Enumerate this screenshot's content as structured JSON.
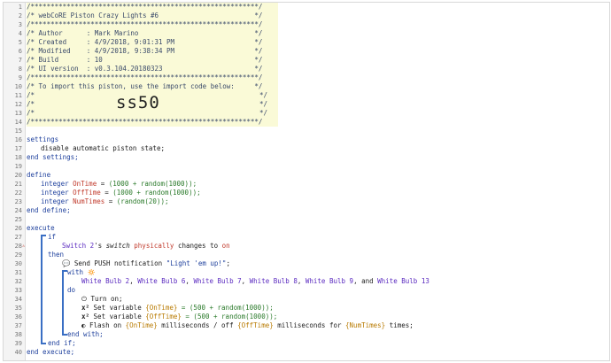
{
  "gutter": {
    "lines": [
      "1",
      "2",
      "3",
      "4",
      "5",
      "6",
      "7",
      "8",
      "9",
      "10",
      "11",
      "12",
      "13",
      "14",
      "15",
      "16",
      "17",
      "18",
      "19",
      "20",
      "21",
      "22",
      "23",
      "24",
      "25",
      "26",
      "27",
      "28",
      "29",
      "30",
      "31",
      "32",
      "33",
      "34",
      "35",
      "36",
      "37",
      "38",
      "39",
      "40"
    ],
    "error_marker": "⚠"
  },
  "header": {
    "rule": "/*********************************************************/",
    "title": "/* webCoRE Piston Crazy Lights #6                        */",
    "author": "/* Author      : Mark Marino                             */",
    "created": "/* Created     : 4/9/2018, 9:01:31 PM                    */",
    "modified": "/* Modified    : 4/9/2018, 9:38:34 PM                    */",
    "build": "/* Build       : 10                                      */",
    "ui_version": "/* UI version  : v0.3.104.20180323                       */",
    "import_text": "/* To import this piston, use the import code below:     */",
    "blank_left": "/*",
    "blank_right": "*/",
    "import_code": "ss50"
  },
  "settings": {
    "open": "settings",
    "body": "disable automatic piston state;",
    "close": "end settings;"
  },
  "define": {
    "open": "define",
    "close": "end define;",
    "vars": [
      {
        "type": "integer",
        "name": "OnTime",
        "eq": " = ",
        "value": "(1000 + random(1000));"
      },
      {
        "type": "integer",
        "name": "OffTime",
        "eq": " = ",
        "value": "(1000 + random(1000));"
      },
      {
        "type": "integer",
        "name": "NumTimes",
        "eq": " = ",
        "value": "(random(20));"
      }
    ]
  },
  "execute": {
    "open": "execute",
    "close": "end execute;",
    "if_kw": "if",
    "cond_device": "Switch 2",
    "cond_poss": "'s ",
    "cond_attr": "switch",
    "cond_phys": "physically",
    "cond_changes": " changes to ",
    "cond_value": "on",
    "then_kw": "then",
    "push_icon": "💬",
    "push_text": "Send PUSH notification ",
    "push_msg": "\"Light 'em up!\"",
    "push_end": ";",
    "with_kw": "with",
    "with_icon": "🔅",
    "devices": [
      {
        "name": "White Bulb 2",
        "sep": ", "
      },
      {
        "name": "White Bulb 6",
        "sep": ", "
      },
      {
        "name": "White Bulb 7",
        "sep": ", "
      },
      {
        "name": "White Bulb 8",
        "sep": ", "
      },
      {
        "name": "White Bulb 9",
        "sep": ", and "
      },
      {
        "name": "White Bulb 13",
        "sep": ""
      }
    ],
    "do_kw": "do",
    "turn_on_icon": "⏻",
    "turn_on": "Turn on;",
    "setvar_icon": "x²",
    "setvar1_text": "Set variable ",
    "setvar1_name": "{OnTime}",
    "setvar1_value": " = (500 + random(1000));",
    "setvar2_text": "Set variable ",
    "setvar2_name": "{OffTime}",
    "setvar2_value": " = (500 + random(1000));",
    "flash_icon": "◐",
    "flash_text1": "Flash on ",
    "flash_on": "{OnTime}",
    "flash_text2": " milliseconds / off ",
    "flash_off": "{OffTime}",
    "flash_text3": " milliseconds for ",
    "flash_times": "{NumTimes}",
    "flash_text4": " times;",
    "end_with": "end with;",
    "end_if": "end if;"
  }
}
